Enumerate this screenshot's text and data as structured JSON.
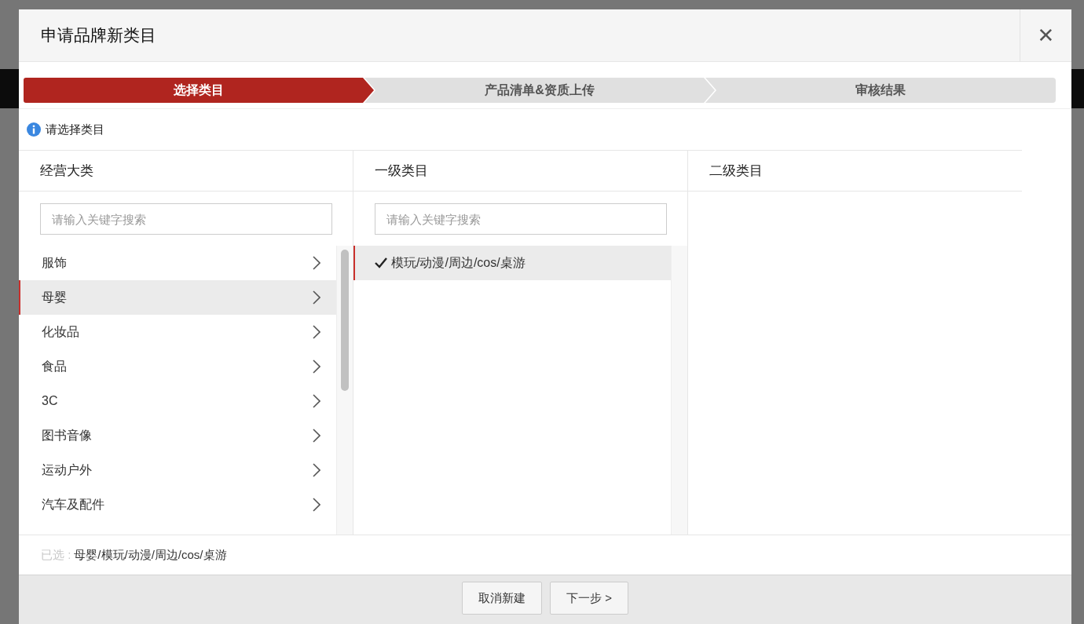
{
  "dialog": {
    "title": "申请品牌新类目",
    "close": "✕"
  },
  "steps": [
    {
      "label": "选择类目",
      "selected": true
    },
    {
      "label": "产品清单&资质上传",
      "selected": false
    },
    {
      "label": "审核结果",
      "selected": false
    }
  ],
  "notice": "请选择类目",
  "columns": [
    {
      "title": "经营大类",
      "search": {
        "placeholder": "请输入关键字搜索"
      },
      "items": [
        {
          "kind": "branch",
          "label": "服饰",
          "selected": false
        },
        {
          "kind": "branch",
          "label": "母婴",
          "selected": true
        },
        {
          "kind": "branch",
          "label": "化妆品",
          "selected": false
        },
        {
          "kind": "branch",
          "label": "食品",
          "selected": false
        },
        {
          "kind": "branch",
          "label": "3C",
          "selected": false
        },
        {
          "kind": "branch",
          "label": "图书音像",
          "selected": false
        },
        {
          "kind": "branch",
          "label": "运动户外",
          "selected": false
        },
        {
          "kind": "branch",
          "label": "汽车及配件",
          "selected": false
        }
      ]
    },
    {
      "title": "一级类目",
      "search": {
        "placeholder": "请输入关键字搜索"
      },
      "items": [
        {
          "kind": "check",
          "label": "模玩/动漫/周边/cos/桌游",
          "selected": true,
          "checked": true
        }
      ]
    },
    {
      "title": "二级类目"
    }
  ],
  "selection": {
    "label": "已选 :",
    "value": "母婴/模玩/动漫/周边/cos/桌游"
  },
  "buttons": [
    "取消新建",
    "下一步 >"
  ]
}
